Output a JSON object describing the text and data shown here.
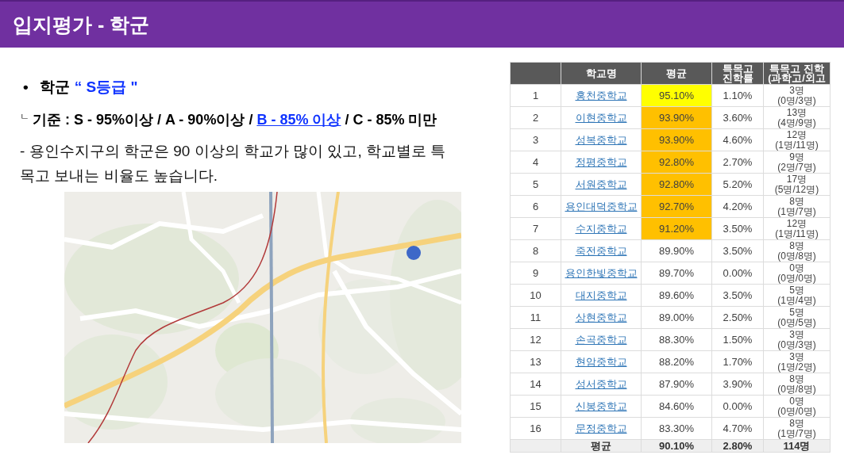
{
  "header": {
    "title": "입지평가 - 학군"
  },
  "bullet": {
    "marker": "•",
    "label": "학군",
    "grade": "“ S등급 \""
  },
  "criteria": {
    "marker": "ㄴ",
    "before": "기준 : S - 95%이상 / A - 90%이상 /",
    "link": "B - 85% 이상",
    "after": "/ C - 85% 미만"
  },
  "description": "- 용인수지구의 학군은 90 이상의 학교가 많이 있고, 학교별로 특목고 보내는 비율도 높습니다.",
  "table": {
    "columns": [
      "학교명",
      "평균",
      "특목고\n진학률",
      "특목고 진학\n(과학고/외고"
    ],
    "rows": [
      {
        "rank": "1",
        "school": "홍천중학교",
        "average": "95.10%",
        "color": "#ffff00",
        "rate": "1.10%",
        "count": "3명",
        "breakdown": "(0명/3명)"
      },
      {
        "rank": "2",
        "school": "이현중학교",
        "average": "93.90%",
        "color": "#ffc000",
        "rate": "3.60%",
        "count": "13명",
        "breakdown": "(4명/9명)"
      },
      {
        "rank": "3",
        "school": "성복중학교",
        "average": "93.90%",
        "color": "#ffc000",
        "rate": "4.60%",
        "count": "12명",
        "breakdown": "(1명/11명)"
      },
      {
        "rank": "4",
        "school": "정평중학교",
        "average": "92.80%",
        "color": "#ffc000",
        "rate": "2.70%",
        "count": "9명",
        "breakdown": "(2명/7명)"
      },
      {
        "rank": "5",
        "school": "서원중학교",
        "average": "92.80%",
        "color": "#ffc000",
        "rate": "5.20%",
        "count": "17명",
        "breakdown": "(5명/12명)"
      },
      {
        "rank": "6",
        "school": "용인대덕중학교",
        "average": "92.70%",
        "color": "#ffc000",
        "rate": "4.20%",
        "count": "8명",
        "breakdown": "(1명/7명)"
      },
      {
        "rank": "7",
        "school": "수지중학교",
        "average": "91.20%",
        "color": "#ffc000",
        "rate": "3.50%",
        "count": "12명",
        "breakdown": "(1명/11명)"
      },
      {
        "rank": "8",
        "school": "죽전중학교",
        "average": "89.90%",
        "rate": "3.50%",
        "count": "8명",
        "breakdown": "(0명/8명)"
      },
      {
        "rank": "9",
        "school": "용인한빛중학교",
        "average": "89.70%",
        "rate": "0.00%",
        "count": "0명",
        "breakdown": "(0명/0명)"
      },
      {
        "rank": "10",
        "school": "대지중학교",
        "average": "89.60%",
        "rate": "3.50%",
        "count": "5명",
        "breakdown": "(1명/4명)"
      },
      {
        "rank": "11",
        "school": "상현중학교",
        "average": "89.00%",
        "rate": "2.50%",
        "count": "5명",
        "breakdown": "(0명/5명)"
      },
      {
        "rank": "12",
        "school": "손곡중학교",
        "average": "88.30%",
        "rate": "1.50%",
        "count": "3명",
        "breakdown": "(0명/3명)"
      },
      {
        "rank": "13",
        "school": "현암중학교",
        "average": "88.20%",
        "rate": "1.70%",
        "count": "3명",
        "breakdown": "(1명/2명)"
      },
      {
        "rank": "14",
        "school": "성서중학교",
        "average": "87.90%",
        "rate": "3.90%",
        "count": "8명",
        "breakdown": "(0명/8명)"
      },
      {
        "rank": "15",
        "school": "신봉중학교",
        "average": "84.60%",
        "rate": "0.00%",
        "count": "0명",
        "breakdown": "(0명/0명)"
      },
      {
        "rank": "16",
        "school": "문정중학교",
        "average": "83.30%",
        "rate": "4.70%",
        "count": "8명",
        "breakdown": "(1명/7명)"
      }
    ],
    "footer": {
      "label": "평균",
      "average": "90.10%",
      "rate": "2.80%",
      "count": "114명"
    }
  }
}
